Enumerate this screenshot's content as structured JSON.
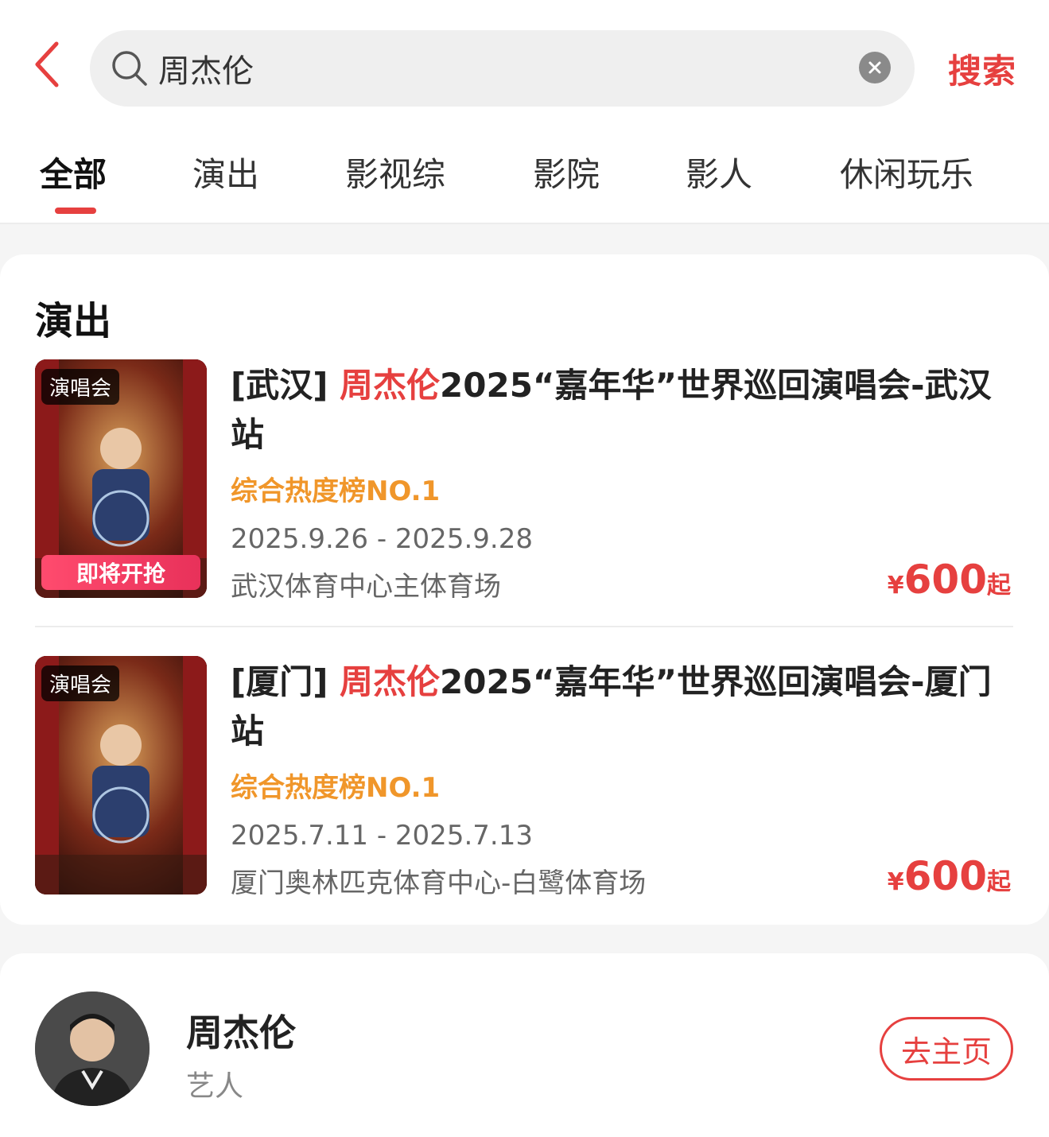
{
  "search": {
    "query": "周杰伦",
    "search_button": "搜索"
  },
  "tabs": [
    {
      "label": "全部",
      "active": true
    },
    {
      "label": "演出",
      "active": false
    },
    {
      "label": "影视综",
      "active": false
    },
    {
      "label": "影院",
      "active": false
    },
    {
      "label": "影人",
      "active": false
    },
    {
      "label": "休闲玩乐",
      "active": false
    }
  ],
  "shows_section": {
    "title": "演出",
    "items": [
      {
        "poster_tag": "演唱会",
        "poster_cta": "即将开抢",
        "city": "[武汉] ",
        "highlight": "周杰伦",
        "title_rest": "2025“嘉年华”世界巡回演唱会-武汉站",
        "rank": "综合热度榜NO.1",
        "date": "2025.9.26 - 2025.9.28",
        "venue": "武汉体育中心主体育场",
        "price_symbol": "¥",
        "price": "600",
        "price_suffix": "起"
      },
      {
        "poster_tag": "演唱会",
        "city": "[厦门] ",
        "highlight": "周杰伦",
        "title_rest": "2025“嘉年华”世界巡回演唱会-厦门站",
        "rank": "综合热度榜NO.1",
        "date": "2025.7.11 - 2025.7.13",
        "venue": "厦门奥林匹克体育中心-白鹭体育场",
        "price_symbol": "¥",
        "price": "600",
        "price_suffix": "起"
      }
    ]
  },
  "artist": {
    "name": "周杰伦",
    "type": "艺人",
    "home_button": "去主页"
  },
  "colors": {
    "accent": "#e6403f",
    "rank": "#f0962a"
  }
}
